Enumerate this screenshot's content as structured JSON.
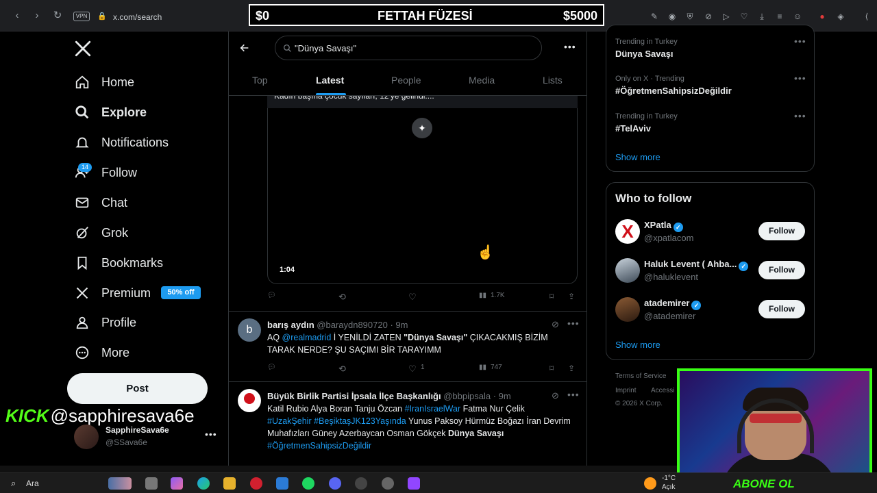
{
  "browser": {
    "vpn_label": "VPN",
    "url": "x.com/search"
  },
  "banner": {
    "left": "$0",
    "title": "FETTAH FÜZESİ",
    "right": "$5000"
  },
  "sidebar": {
    "items": [
      {
        "label": "Home",
        "icon": "home-icon"
      },
      {
        "label": "Explore",
        "icon": "search-icon"
      },
      {
        "label": "Notifications",
        "icon": "bell-icon"
      },
      {
        "label": "Follow",
        "icon": "person-add-icon"
      },
      {
        "label": "Chat",
        "icon": "mail-icon"
      },
      {
        "label": "Grok",
        "icon": "grok-icon"
      },
      {
        "label": "Bookmarks",
        "icon": "bookmark-icon"
      },
      {
        "label": "Premium",
        "icon": "x-logo-icon"
      },
      {
        "label": "Profile",
        "icon": "person-icon"
      },
      {
        "label": "More",
        "icon": "more-circle-icon"
      }
    ],
    "notifications_badge": "14",
    "premium_pill": "50% off",
    "post_button": "Post",
    "account_name": "SapphireSava6e",
    "account_handle": "@SSava6e"
  },
  "overlay": {
    "kick_brand": "KICK",
    "kick_handle": "@sapphiresava6e",
    "cam_label": "ABONE OL"
  },
  "search": {
    "query": "\"Dünya Savaşı\""
  },
  "tabs": [
    "Top",
    "Latest",
    "People",
    "Media",
    "Lists"
  ],
  "video_post": {
    "caption_partial": "Kadın başına çocuk sayıları, 12'ye gelindi....",
    "duration": "1:04",
    "views": "1.7K"
  },
  "tweets": [
    {
      "name": "barış aydın",
      "handle": "@baraydn890720",
      "time": "9m",
      "avatar_letter": "b",
      "text_prefix": "AQ ",
      "mention": "@realmadrid",
      "text_mid": " İ YENİLDİ ZATEN  ",
      "bold": "\"Dünya Savaşı\"",
      "text_suffix": " ÇIKACAKMIŞ BİZİM TARAK NERDE? ŞU SAÇIMI BİR TARAYIMM",
      "likes": "1",
      "views": "747"
    },
    {
      "name": "Büyük Birlik Partisi İpsala İlçe Başkanlığı",
      "handle": "@bbpipsala",
      "time": "9m",
      "text_a": "Katil Rubio Alya Boran Tanju Özcan ",
      "tag1": "#IranIsraelWar",
      "text_b": " Fatma Nur Çelik",
      "tag2": "#UzakŞehir",
      "tag3": "#BeşiktaşJK123Yaşında",
      "text_c": " Yunus Paksoy Hürmüz Boğazı İran Devrim Muhafızları Güney Azerbaycan Osman Gökçek ",
      "bold": "Dünya Savaşı",
      "tag4": "#ÖğretmenSahipsizDeğildir"
    }
  ],
  "trends": [
    {
      "meta": "Trending in Turkey",
      "name": "Dünya Savaşı"
    },
    {
      "meta": "Only on X · Trending",
      "name": "#ÖğretmenSahipsizDeğildir"
    },
    {
      "meta": "Trending in Turkey",
      "name": "#TelAviv"
    }
  ],
  "show_more": "Show more",
  "who_to_follow": {
    "title": "Who to follow",
    "accounts": [
      {
        "name": "XPatla",
        "handle": "@xpatlacom",
        "button": "Follow"
      },
      {
        "name": "Haluk Levent ( Ahba...",
        "handle": "@haluklevent",
        "button": "Follow"
      },
      {
        "name": "atademirer",
        "handle": "@atademirer",
        "button": "Follow"
      }
    ],
    "show_more": "Show more"
  },
  "footer": {
    "terms": "Terms of Service",
    "imprint": "Imprint",
    "access": "Accessi",
    "copyright": "© 2026 X Corp."
  },
  "taskbar": {
    "search_label": "Ara",
    "weather_temp": "-1°C",
    "weather_desc": "Açık"
  },
  "colors": {
    "accent": "#1d9bf0",
    "kick_green": "#53fc18",
    "background": "#000000"
  }
}
